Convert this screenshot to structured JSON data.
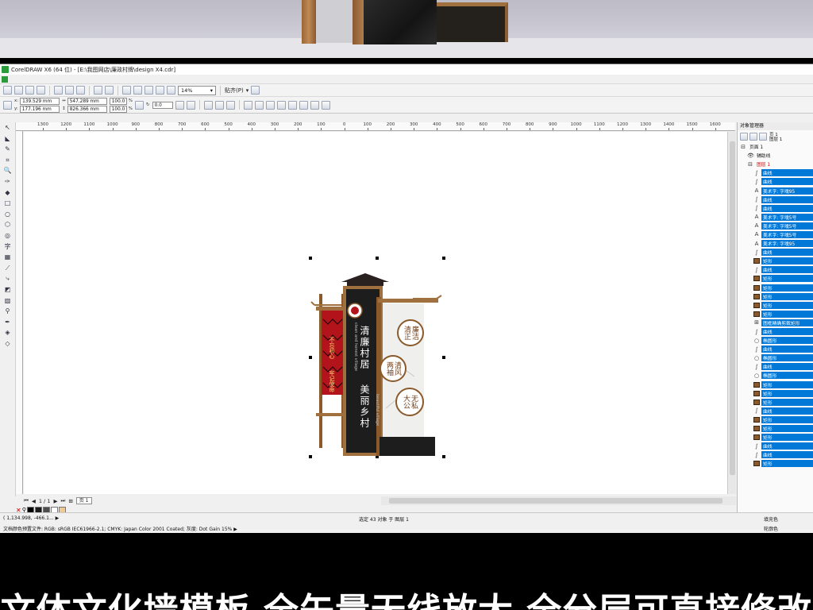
{
  "window": {
    "title": "CorelDRAW X6 (64 位) - [E:\\我图网店\\廉政村牌\\design X4.cdr]"
  },
  "toolbar": {
    "zoom": "14%",
    "snap_label": "贴齐(P)"
  },
  "property_bar": {
    "x": "139.529 mm",
    "y": "177.196 mm",
    "width": "547.289 mm",
    "height": "826.366 mm",
    "scale_x": "100.0",
    "scale_y": "100.0",
    "percent": "%",
    "angle": "0.0"
  },
  "ruler": {
    "ticks": [
      "1300",
      "1200",
      "1100",
      "1000",
      "900",
      "800",
      "700",
      "600",
      "500",
      "400",
      "300",
      "200",
      "100",
      "0",
      "100",
      "200",
      "300",
      "400",
      "500",
      "600",
      "700",
      "800",
      "900",
      "1000",
      "1100",
      "1200",
      "1300",
      "1400",
      "1500",
      "1600"
    ]
  },
  "page_nav": {
    "counter": "1 / 1",
    "page_tab": "页 1"
  },
  "palette": [
    "#000000",
    "#1a1a1a",
    "#4d4d4d",
    "#ffffff",
    "#f0c890"
  ],
  "sign": {
    "main_title": "清廉村居",
    "main_title_2": "美丽乡村",
    "subtitle_en": "clean and honest village",
    "subtitle_en_2": "beautiful village",
    "red_banner_1": "不忘初心",
    "red_banner_2": "牢记使命",
    "seal_1": "廉洁",
    "seal_1b": "清正",
    "seal_2": "清风",
    "seal_2b": "两袖",
    "seal_3": "无私",
    "seal_3b": "大公"
  },
  "docker": {
    "title": "对象管理器",
    "page_info": "页 1\n图层 1",
    "tree": [
      {
        "label": "页面 1",
        "glyph": "⊟",
        "sel": false
      },
      {
        "label": "辅助线",
        "glyph": "👁",
        "sel": false
      },
      {
        "label": "图层 1",
        "glyph": "⊟",
        "sel": false
      },
      {
        "label": "曲线",
        "glyph": "∫",
        "sel": true
      },
      {
        "label": "曲线",
        "glyph": "∫",
        "sel": true
      },
      {
        "label": "美术字: 字魂95",
        "glyph": "A",
        "sel": true
      },
      {
        "label": "曲线",
        "glyph": "∫",
        "sel": true
      },
      {
        "label": "曲线",
        "glyph": "∫",
        "sel": true
      },
      {
        "label": "美术字: 字魂5号",
        "glyph": "A",
        "sel": true
      },
      {
        "label": "美术字: 字魂5号",
        "glyph": "A",
        "sel": true
      },
      {
        "label": "美术字: 字魂5号",
        "glyph": "A",
        "sel": true
      },
      {
        "label": "美术字: 字魂95",
        "glyph": "A",
        "sel": true
      },
      {
        "label": "曲线",
        "glyph": "∫",
        "sel": true
      },
      {
        "label": "矩形",
        "glyph": "■",
        "sel": true
      },
      {
        "label": "曲线",
        "glyph": "∫",
        "sel": true
      },
      {
        "label": "矩形",
        "glyph": "■",
        "sel": true
      },
      {
        "label": "矩形",
        "glyph": "■",
        "sel": true
      },
      {
        "label": "矩形",
        "glyph": "■",
        "sel": true
      },
      {
        "label": "矩形",
        "glyph": "■",
        "sel": true
      },
      {
        "label": "矩形",
        "glyph": "■",
        "sel": true
      },
      {
        "label": "图框精确剪裁矩形",
        "glyph": "⊞",
        "sel": true
      },
      {
        "label": "曲线",
        "glyph": "∫",
        "sel": true
      },
      {
        "label": "椭圆形",
        "glyph": "○",
        "sel": true
      },
      {
        "label": "曲线",
        "glyph": "∫",
        "sel": true
      },
      {
        "label": "椭圆形",
        "glyph": "○",
        "sel": true
      },
      {
        "label": "曲线",
        "glyph": "∫",
        "sel": true
      },
      {
        "label": "椭圆形",
        "glyph": "○",
        "sel": true
      },
      {
        "label": "矩形",
        "glyph": "■",
        "sel": true
      },
      {
        "label": "矩形",
        "glyph": "■",
        "sel": true
      },
      {
        "label": "矩形",
        "glyph": "■",
        "sel": true
      },
      {
        "label": "曲线",
        "glyph": "∫",
        "sel": true
      },
      {
        "label": "矩形",
        "glyph": "■",
        "sel": true
      },
      {
        "label": "矩形",
        "glyph": "■",
        "sel": true
      },
      {
        "label": "矩形",
        "glyph": "■",
        "sel": true
      },
      {
        "label": "曲线",
        "glyph": "∫",
        "sel": true
      },
      {
        "label": "曲线",
        "glyph": "∫",
        "sel": true
      },
      {
        "label": "矩形",
        "glyph": "■",
        "sel": true
      }
    ]
  },
  "status": {
    "coords": "( 1,134.998, -466.1... ▶",
    "color_profile": "文档颜色预置文件: RGB: sRGB IEC61966-2.1; CMYK: Japan Color 2001 Coated; 灰度: Dot Gain 15% ▶",
    "selection": "选定 43 对象 于 图层 1",
    "fill": "填充色",
    "outline": "轮廓色"
  },
  "banner": {
    "caption": "文体文化墙模板 全矢量无线放大 全分层可直接修改"
  }
}
